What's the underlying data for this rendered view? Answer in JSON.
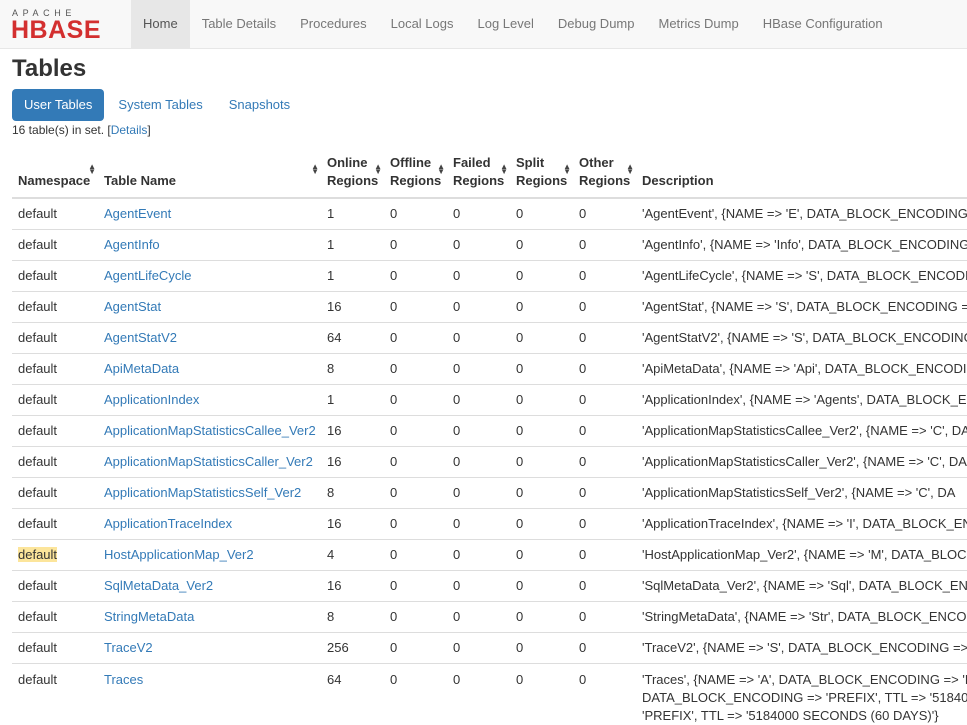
{
  "logo": {
    "apache": "APACHE",
    "hbase": "HBASE"
  },
  "nav": [
    "Home",
    "Table Details",
    "Procedures",
    "Local Logs",
    "Log Level",
    "Debug Dump",
    "Metrics Dump",
    "HBase Configuration"
  ],
  "page_title": "Tables",
  "tabs": [
    "User Tables",
    "System Tables",
    "Snapshots"
  ],
  "summary": {
    "prefix": "16 table(s) in set. [",
    "link": "Details",
    "suffix": "]"
  },
  "columns": [
    "Namespace",
    "Table Name",
    "Online Regions",
    "Offline Regions",
    "Failed Regions",
    "Split Regions",
    "Other Regions",
    "Description"
  ],
  "rows": [
    {
      "ns": "default",
      "name": "AgentEvent",
      "online": "1",
      "offline": "0",
      "failed": "0",
      "split": "0",
      "other": "0",
      "desc": "'AgentEvent', {NAME => 'E', DATA_BLOCK_ENCODING =>"
    },
    {
      "ns": "default",
      "name": "AgentInfo",
      "online": "1",
      "offline": "0",
      "failed": "0",
      "split": "0",
      "other": "0",
      "desc": "'AgentInfo', {NAME => 'Info', DATA_BLOCK_ENCODING"
    },
    {
      "ns": "default",
      "name": "AgentLifeCycle",
      "online": "1",
      "offline": "0",
      "failed": "0",
      "split": "0",
      "other": "0",
      "desc": "'AgentLifeCycle', {NAME => 'S', DATA_BLOCK_ENCODIN"
    },
    {
      "ns": "default",
      "name": "AgentStat",
      "online": "16",
      "offline": "0",
      "failed": "0",
      "split": "0",
      "other": "0",
      "desc": "'AgentStat', {NAME => 'S', DATA_BLOCK_ENCODING =>"
    },
    {
      "ns": "default",
      "name": "AgentStatV2",
      "online": "64",
      "offline": "0",
      "failed": "0",
      "split": "0",
      "other": "0",
      "desc": "'AgentStatV2', {NAME => 'S', DATA_BLOCK_ENCODING"
    },
    {
      "ns": "default",
      "name": "ApiMetaData",
      "online": "8",
      "offline": "0",
      "failed": "0",
      "split": "0",
      "other": "0",
      "desc": "'ApiMetaData', {NAME => 'Api', DATA_BLOCK_ENCODIN"
    },
    {
      "ns": "default",
      "name": "ApplicationIndex",
      "online": "1",
      "offline": "0",
      "failed": "0",
      "split": "0",
      "other": "0",
      "desc": "'ApplicationIndex', {NAME => 'Agents', DATA_BLOCK_EN"
    },
    {
      "ns": "default",
      "name": "ApplicationMapStatisticsCallee_Ver2",
      "online": "16",
      "offline": "0",
      "failed": "0",
      "split": "0",
      "other": "0",
      "desc": "'ApplicationMapStatisticsCallee_Ver2', {NAME => 'C', DA"
    },
    {
      "ns": "default",
      "name": "ApplicationMapStatisticsCaller_Ver2",
      "online": "16",
      "offline": "0",
      "failed": "0",
      "split": "0",
      "other": "0",
      "desc": "'ApplicationMapStatisticsCaller_Ver2', {NAME => 'C', DA"
    },
    {
      "ns": "default",
      "name": "ApplicationMapStatisticsSelf_Ver2",
      "online": "8",
      "offline": "0",
      "failed": "0",
      "split": "0",
      "other": "0",
      "desc": "'ApplicationMapStatisticsSelf_Ver2', {NAME => 'C', DA"
    },
    {
      "ns": "default",
      "name": "ApplicationTraceIndex",
      "online": "16",
      "offline": "0",
      "failed": "0",
      "split": "0",
      "other": "0",
      "desc": "'ApplicationTraceIndex', {NAME => 'I', DATA_BLOCK_EN"
    },
    {
      "ns": "default",
      "name": "HostApplicationMap_Ver2",
      "online": "4",
      "offline": "0",
      "failed": "0",
      "split": "0",
      "other": "0",
      "desc": "'HostApplicationMap_Ver2', {NAME => 'M', DATA_BLOCK",
      "highlight": true
    },
    {
      "ns": "default",
      "name": "SqlMetaData_Ver2",
      "online": "16",
      "offline": "0",
      "failed": "0",
      "split": "0",
      "other": "0",
      "desc": "'SqlMetaData_Ver2', {NAME => 'Sql', DATA_BLOCK_ENC"
    },
    {
      "ns": "default",
      "name": "StringMetaData",
      "online": "8",
      "offline": "0",
      "failed": "0",
      "split": "0",
      "other": "0",
      "desc": "'StringMetaData', {NAME => 'Str', DATA_BLOCK_ENCOD"
    },
    {
      "ns": "default",
      "name": "TraceV2",
      "online": "256",
      "offline": "0",
      "failed": "0",
      "split": "0",
      "other": "0",
      "desc": "'TraceV2', {NAME => 'S', DATA_BLOCK_ENCODING => '"
    },
    {
      "ns": "default",
      "name": "Traces",
      "online": "64",
      "offline": "0",
      "failed": "0",
      "split": "0",
      "other": "0",
      "desc_lines": [
        "'Traces', {NAME => 'A', DATA_BLOCK_ENCODING => 'P",
        "DATA_BLOCK_ENCODING => 'PREFIX', TTL => '518400",
        "'PREFIX', TTL => '5184000 SECONDS (60 DAYS)'}"
      ]
    }
  ]
}
